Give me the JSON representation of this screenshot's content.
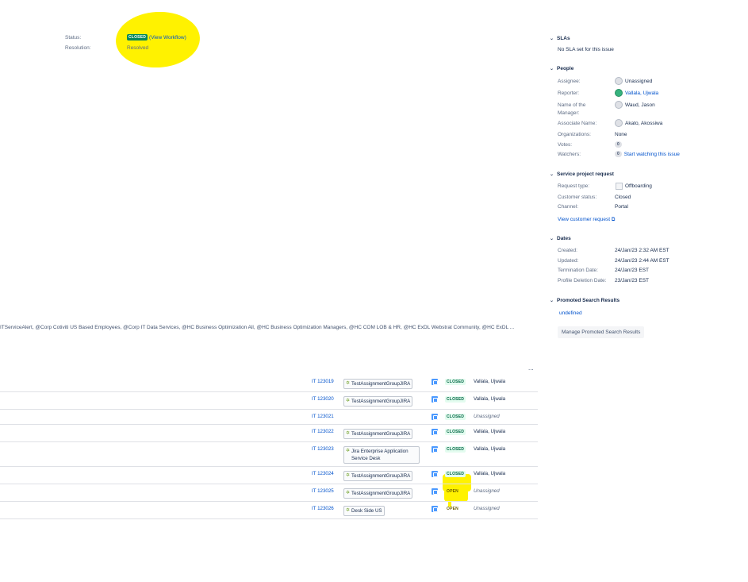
{
  "details": {
    "status_label": "Status:",
    "status_value": "CLOSED",
    "view_workflow": "(View Workflow)",
    "resolution_label": "Resolution:",
    "resolution_value": "Resolved"
  },
  "request_participants_text": "ITServiceAlert, @Corp Cotiviti US Based Employees, @Corp IT Data Services, @HC Business Optimization All, @HC Business Optimization Managers, @HC COM LOB & HR, @HC ExDL Webstrat Community, @HC ExDL ...",
  "sidebar": {
    "slas": {
      "title": "SLAs",
      "empty": "No SLA set for this issue"
    },
    "people": {
      "title": "People",
      "assignee_label": "Assignee:",
      "assignee_value": "Unassigned",
      "reporter_label": "Reporter:",
      "reporter_value": "Vallala, Ujwala",
      "manager_label_1": "Name of the",
      "manager_label_2": "Manager:",
      "manager_value": "Waud, Jason",
      "associate_label": "Associate Name:",
      "associate_value": "Akato, Akossiwa",
      "orgs_label": "Organizations:",
      "orgs_value": "None",
      "votes_label": "Votes:",
      "votes_value": "0",
      "watchers_label": "Watchers:",
      "watchers_count": "0",
      "watchers_link": "Start watching this issue"
    },
    "service_request": {
      "title": "Service project request",
      "request_type_label": "Request type:",
      "request_type_value": "Offboarding",
      "customer_status_label": "Customer status:",
      "customer_status_value": "Closed",
      "channel_label": "Channel:",
      "channel_value": "Portal",
      "view_link": "View customer request ⧉"
    },
    "dates": {
      "title": "Dates",
      "created_label": "Created:",
      "created_value": "24/Jan/23 2:32 AM EST",
      "updated_label": "Updated:",
      "updated_value": "24/Jan/23 2:44 AM EST",
      "termination_label": "Termination Date:",
      "termination_value": "24/Jan/23 EST",
      "profile_label": "Profile Deletion Date:",
      "profile_value": "23/Jan/23 EST"
    },
    "promoted": {
      "title": "Promoted Search Results",
      "undefined_text": "undefined",
      "manage_button": "Manage Promoted Search Results"
    }
  },
  "more_actions": "...",
  "subtasks": [
    {
      "key": "IT 123019",
      "group": "TestAssignmentGroupJIRA",
      "status": "CLOSED",
      "assignee": "Vallala, Ujwala"
    },
    {
      "key": "IT 123020",
      "group": "TestAssignmentGroupJIRA",
      "status": "CLOSED",
      "assignee": "Vallala, Ujwala"
    },
    {
      "key": "IT 123021",
      "group": "",
      "status": "CLOSED",
      "assignee": "Unassigned"
    },
    {
      "key": "IT 123022",
      "group": "TestAssignmentGroupJIRA",
      "status": "CLOSED",
      "assignee": "Vallala, Ujwala"
    },
    {
      "key": "IT 123023",
      "group": "Jira Enterprise Application Service Desk",
      "status": "CLOSED",
      "assignee": "Vallala, Ujwala"
    },
    {
      "key": "IT 123024",
      "group": "TestAssignmentGroupJIRA",
      "status": "CLOSED",
      "assignee": "Vallala, Ujwala"
    },
    {
      "key": "IT 123025",
      "group": "TestAssignmentGroupJIRA",
      "status": "OPEN",
      "assignee": "Unassigned"
    },
    {
      "key": "IT 123026",
      "group": "Desk Side US",
      "status": "OPEN",
      "assignee": "Unassigned"
    }
  ]
}
